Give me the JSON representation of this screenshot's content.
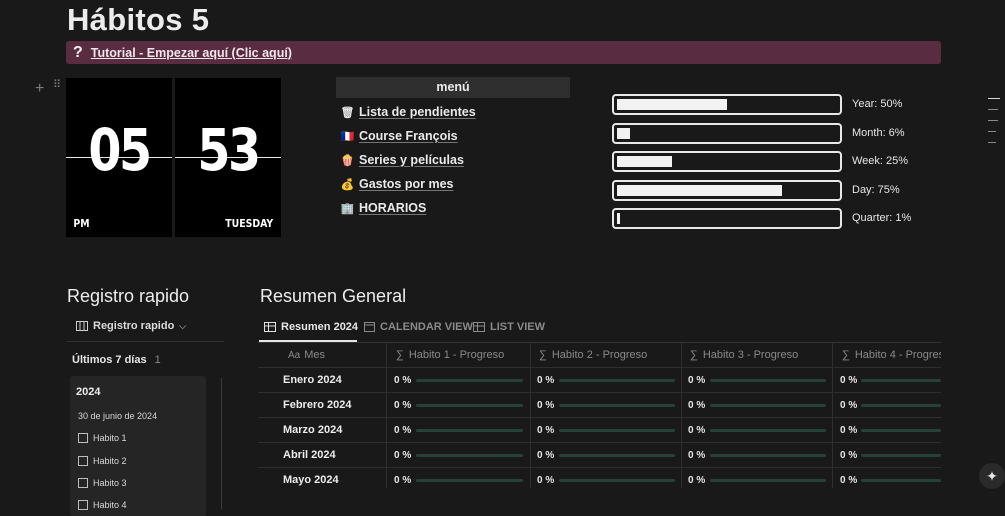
{
  "page": {
    "title": "Hábitos 5",
    "callout_icon": "?",
    "callout_text": "Tutorial - Empezar aquí (Clic aquí)"
  },
  "clock": {
    "hour": "05",
    "minute": "53",
    "ampm": "PM",
    "weekday": "TUESDAY"
  },
  "menu": {
    "header": "menú",
    "items": [
      {
        "icon": "🗑",
        "label": "Lista de pendientes"
      },
      {
        "icon": "🇫🇷",
        "label": "Course François"
      },
      {
        "icon": "🍿",
        "label": "Series y películas"
      },
      {
        "icon": "💰",
        "label": "Gastos por mes"
      },
      {
        "icon": "🏢",
        "label": "HORARIOS"
      }
    ]
  },
  "progress": [
    {
      "label": "Year: 50%",
      "fraction": 0.5
    },
    {
      "label": "Month: 6%",
      "fraction": 0.06
    },
    {
      "label": "Week: 25%",
      "fraction": 0.25
    },
    {
      "label": "Day: 75%",
      "fraction": 0.75
    },
    {
      "label": "Quarter: 1%",
      "fraction": 0.01
    }
  ],
  "registro": {
    "title": "Registro rapido",
    "view_label": "Registro rapido",
    "group_label": "Últimos 7 días",
    "group_count": "1",
    "card_title": "2024",
    "card_date": "30 de junio de 2024",
    "habits": [
      "Habito 1",
      "Habito 2",
      "Habito 3",
      "Habito 4"
    ]
  },
  "resumen": {
    "title": "Resumen General",
    "tabs": [
      "Resumen 2024",
      "CALENDAR VIEW",
      "LIST VIEW"
    ],
    "columns": [
      "Mes",
      "Habito 1 - Progreso",
      "Habito 2 - Progreso",
      "Habito 3 - Progreso",
      "Habito 4 - Progres"
    ],
    "rows": [
      {
        "mes": "Enero 2024",
        "values": [
          "0 %",
          "0 %",
          "0 %",
          "0 %"
        ]
      },
      {
        "mes": "Febrero 2024",
        "values": [
          "0 %",
          "0 %",
          "0 %",
          "0 %"
        ]
      },
      {
        "mes": "Marzo 2024",
        "values": [
          "0 %",
          "0 %",
          "0 %",
          "0 %"
        ]
      },
      {
        "mes": "Abril 2024",
        "values": [
          "0 %",
          "0 %",
          "0 %",
          "0 %"
        ]
      },
      {
        "mes": "Mayo 2024",
        "values": [
          "0 %",
          "0 %",
          "0 %",
          "0 %"
        ]
      }
    ]
  },
  "colors": {
    "callout_bg": "#5a2c41",
    "progress_track": "#264136"
  }
}
